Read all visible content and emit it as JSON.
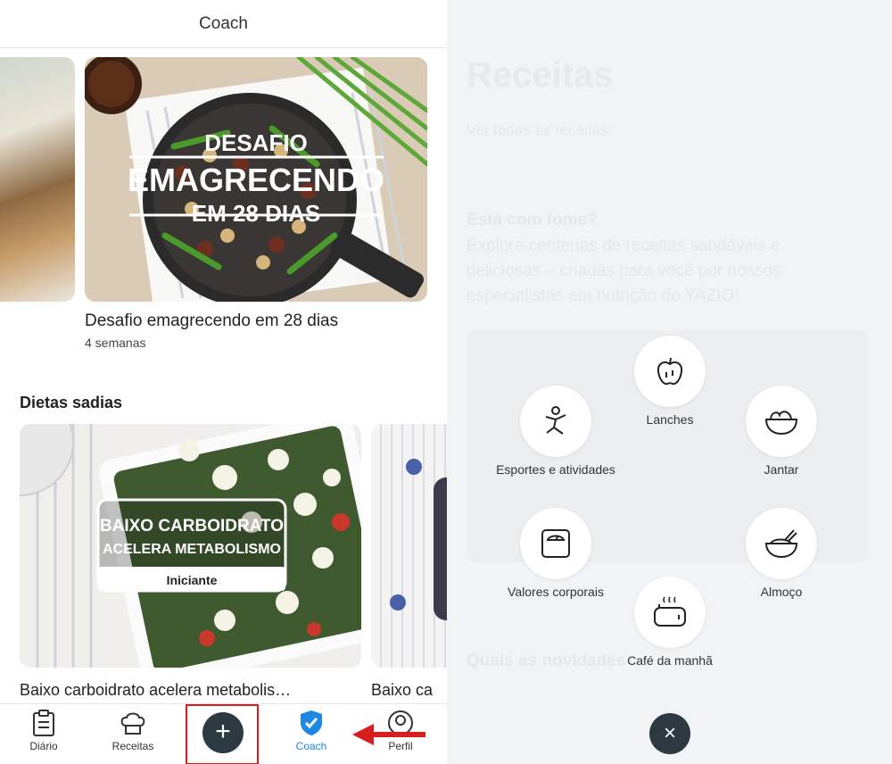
{
  "header": {
    "title": "Coach"
  },
  "plans": [
    {
      "title": "Desafio emagrecendo em 28 dias",
      "subtitle": "4 semanas",
      "image_text": [
        "DESAFIO",
        "EMAGRECENDO",
        "EM 28 DIAS"
      ]
    }
  ],
  "diets_section": {
    "heading": "Dietas sadias",
    "cards": [
      {
        "title": "Baixo carboidrato acelera metabolis…",
        "image_text": [
          "BAIXO CARBOIDRATO",
          "ACELERA METABOLISMO"
        ],
        "badge": "Iniciante"
      },
      {
        "title": "Baixo ca"
      }
    ]
  },
  "bottom_nav": {
    "items": [
      {
        "label": "Diário",
        "icon": "clipboard-icon"
      },
      {
        "label": "Receitas",
        "icon": "chef-hat-icon"
      },
      {
        "label": "+",
        "icon": "plus-icon"
      },
      {
        "label": "Coach",
        "icon": "shield-check-icon"
      },
      {
        "label": "Perfil",
        "icon": "person-icon"
      }
    ]
  },
  "overlay": {
    "items": [
      {
        "label": "Lanches",
        "icon": "apple-icon"
      },
      {
        "label": "Esportes e atividades",
        "icon": "running-figure-icon"
      },
      {
        "label": "Jantar",
        "icon": "salad-bowl-icon"
      },
      {
        "label": "Valores corporais",
        "icon": "scale-icon"
      },
      {
        "label": "Almoço",
        "icon": "rice-bowl-icon"
      },
      {
        "label": "Café da manhã",
        "icon": "toaster-icon"
      }
    ],
    "close_label": "×"
  },
  "faded_background": {
    "title": "Receitas",
    "subtitle": "Ver todas as receitas",
    "heading": "Está com fome?",
    "paragraph": "Explore centenas de receitas saudáveis e deliciosas – criadas para você por nossos especialistas em nutrição do YAZIO!",
    "lower_heading": "Quais as novidades"
  },
  "colors": {
    "accent": "#1e88e5",
    "dark_button": "#2d3941",
    "highlight": "#d91c1c",
    "overlay_bg": "#f1f3f5"
  }
}
